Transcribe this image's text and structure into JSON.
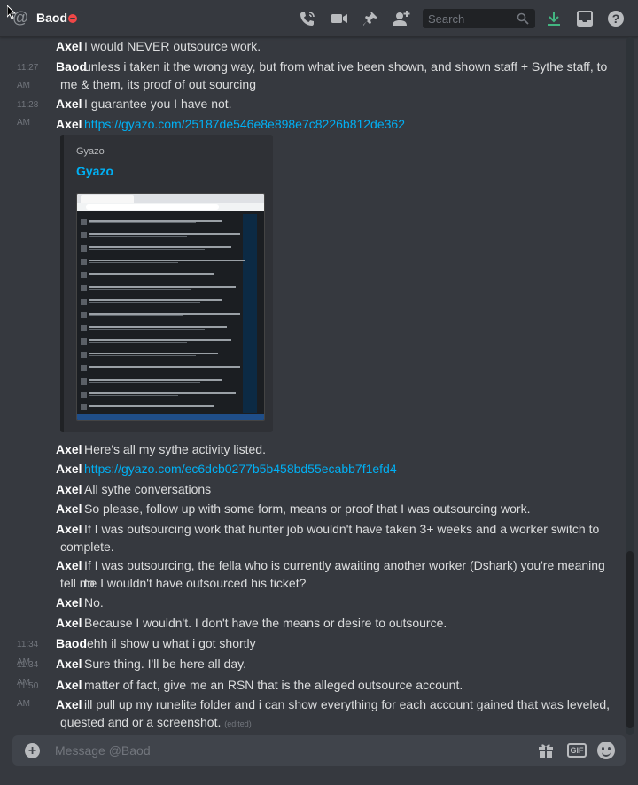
{
  "header": {
    "title": "Baod",
    "search_placeholder": "Search",
    "icons": [
      "call-icon",
      "video-call-icon",
      "pin-icon",
      "add-friend-icon",
      "download-icon",
      "inbox-icon",
      "help-icon"
    ]
  },
  "colors": {
    "background": "#36393f",
    "link": "#00b0f4",
    "dnd_status": "#f04747",
    "download_icon": "#43b581"
  },
  "messages": [
    {
      "time": "",
      "author": "Axel",
      "text": "I would NEVER outsource work."
    },
    {
      "time": "11:27 AM",
      "author": "Baod",
      "text": "unless i taken it the wrong way, but from what ive been shown, and shown staff + Sythe staff, to",
      "text2": "me & them, its proof of out sourcing"
    },
    {
      "time": "11:28 AM",
      "author": "Axel",
      "text": "I guarantee you I have not."
    },
    {
      "time": "",
      "author": "Axel",
      "link": "https://gyazo.com/25187de546e8e898e7c8226b812de362"
    },
    {
      "time": "",
      "author": "Axel",
      "text": "Here's all my sythe activity listed."
    },
    {
      "time": "",
      "author": "Axel",
      "link": "https://gyazo.com/ec6dcb0277b5b458bd55ecabb7f1efd4"
    },
    {
      "time": "",
      "author": "Axel",
      "text": "All sythe conversations"
    },
    {
      "time": "",
      "author": "Axel",
      "text": "So please, follow up with some form, means or proof that I was outsourcing work."
    },
    {
      "time": "",
      "author": "Axel",
      "text": "If I was outsourcing work that hunter job wouldn't have taken 3+ weeks and a worker switch to",
      "text2": "complete."
    },
    {
      "time": "",
      "author": "Axel",
      "text": "If I was outsourcing, the fella who is currently awaiting another worker (Dshark) you're meaning to",
      "text2": "tell me I wouldn't have outsourced his ticket?"
    },
    {
      "time": "",
      "author": "Axel",
      "text": "No."
    },
    {
      "time": "",
      "author": "Axel",
      "text": "Because I wouldn't. I don't have the means or desire to outsource."
    },
    {
      "time": "11:34 AM",
      "author": "Baod",
      "text": "ehh il show u what i got shortly"
    },
    {
      "time": "11:34 AM",
      "author": "Axel",
      "text": "Sure thing. I'll be here all day."
    },
    {
      "time": "11:50 AM",
      "author": "Axel",
      "text": "matter of fact, give me an RSN that is the alleged outsource account."
    },
    {
      "time": "",
      "author": "Axel",
      "text": "ill pull up my runelite folder and i can show everything for each account gained that was leveled,",
      "text2": "quested and or a screenshot.",
      "edited": "(edited)"
    }
  ],
  "embed": {
    "provider": "Gyazo",
    "title": "Gyazo"
  },
  "composer": {
    "placeholder": "Message @Baod",
    "gif_label": "GIF"
  }
}
